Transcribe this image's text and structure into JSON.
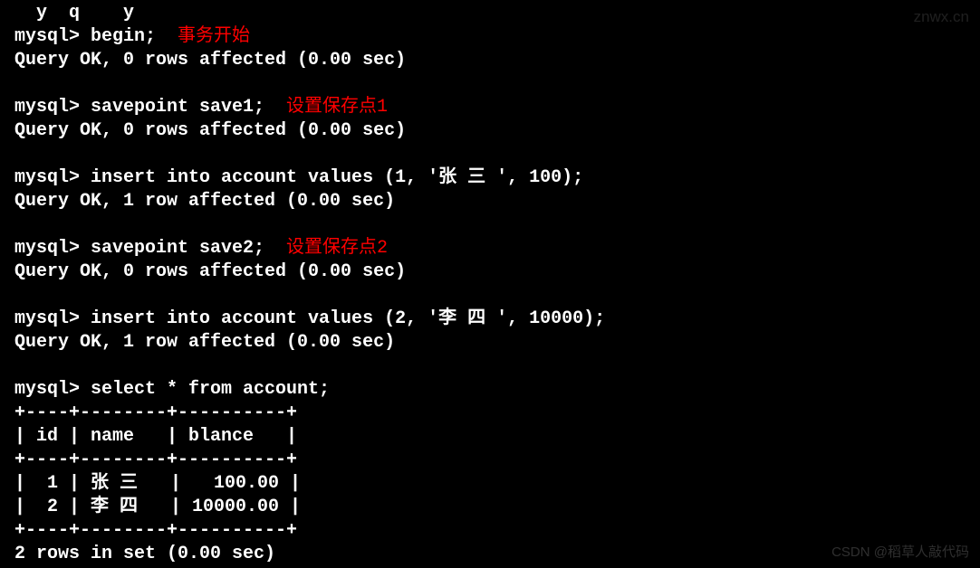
{
  "lines": {
    "truncated": "  y  q    y",
    "begin_prompt": "mysql> begin;",
    "begin_annotation": "事务开始",
    "begin_result": "Query OK, 0 rows affected (0.00 sec)",
    "savepoint1_prompt": "mysql> savepoint save1;",
    "savepoint1_annotation": "设置保存点1",
    "savepoint1_result": "Query OK, 0 rows affected (0.00 sec)",
    "insert1_prompt": "mysql> insert into account values (1, '张 三 ', 100);",
    "insert1_result": "Query OK, 1 row affected (0.00 sec)",
    "savepoint2_prompt": "mysql> savepoint save2;",
    "savepoint2_annotation": "设置保存点2",
    "savepoint2_result": "Query OK, 0 rows affected (0.00 sec)",
    "insert2_prompt": "mysql> insert into account values (2, '李 四 ', 10000);",
    "insert2_result": "Query OK, 1 row affected (0.00 sec)",
    "select_prompt": "mysql> select * from account;",
    "table_border": "+----+--------+----------+",
    "table_header": "| id | name   | blance   |",
    "table_row1": "|  1 | 张 三   |   100.00 |",
    "table_row2": "|  2 | 李 四   | 10000.00 |",
    "select_result": "2 rows in set (0.00 sec)"
  },
  "watermarks": {
    "top": "znwx.cn",
    "bottom": "CSDN @稻草人敲代码"
  }
}
